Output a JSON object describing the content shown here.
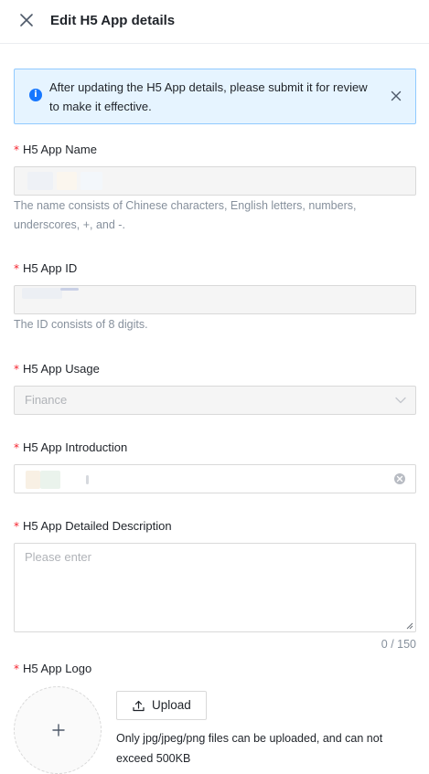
{
  "header": {
    "title": "Edit H5 App details",
    "close_icon": "close-icon"
  },
  "alert": {
    "text": "After updating the H5 App details, please submit it for review to make it effective.",
    "icon": "info-icon",
    "close_icon": "close-icon",
    "color": "#1677ff"
  },
  "form": {
    "required_mark": "*",
    "name": {
      "label": "H5 App Name",
      "help": "The name consists of Chinese characters, English letters, numbers, underscores, +, and -."
    },
    "app_id": {
      "label": "H5 App ID",
      "help": "The ID consists of 8 digits."
    },
    "usage": {
      "label": "H5 App Usage",
      "selected": "Finance"
    },
    "introduction": {
      "label": "H5 App Introduction"
    },
    "description": {
      "label": "H5 App Detailed Description",
      "placeholder": "Please enter",
      "counter": "0 / 150"
    },
    "logo": {
      "label": "H5 App Logo",
      "upload_label": "Upload",
      "hint": "Only jpg/jpeg/png files can be uploaded, and can not exceed 500KB"
    }
  },
  "colors": {
    "required": "#f5222d",
    "accent": "#1677ff",
    "alert_bg": "#e6f4ff",
    "alert_border": "#91caff"
  }
}
